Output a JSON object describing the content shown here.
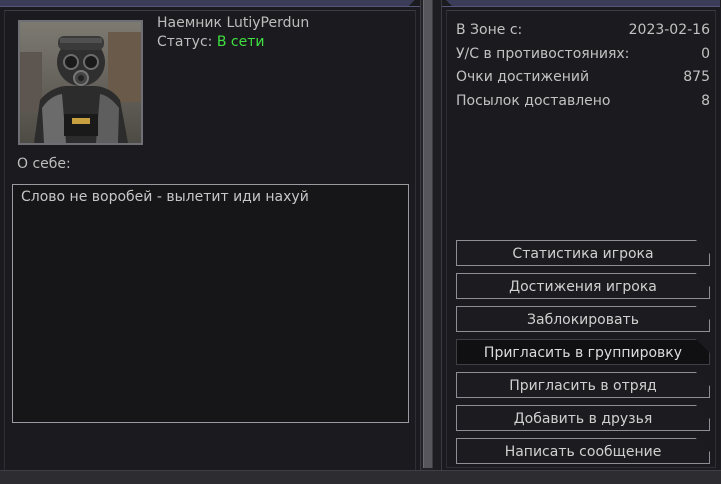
{
  "profile": {
    "nick": "Наемник LutiyPerdun",
    "status_label": "Статус:",
    "status_value": "В сети",
    "about_label": "О себе:",
    "about_text": "Слово не воробей - вылетит иди нахуй"
  },
  "stats": [
    {
      "label": "В Зоне с:",
      "value": "2023-02-16"
    },
    {
      "label": "У/С в противостояниях:",
      "value": "0"
    },
    {
      "label": "Очки достижений",
      "value": "875"
    },
    {
      "label": "Посылок доставлено",
      "value": "8"
    }
  ],
  "buttons": [
    {
      "label": "Статистика игрока"
    },
    {
      "label": "Достижения игрока"
    },
    {
      "label": "Заблокировать"
    },
    {
      "label": "Пригласить в группировку"
    },
    {
      "label": "Пригласить в отряд"
    },
    {
      "label": "Добавить в друзья"
    },
    {
      "label": "Написать сообщение"
    }
  ],
  "colors": {
    "online": "#3fe03f",
    "header_strip": "#3a3c58"
  }
}
